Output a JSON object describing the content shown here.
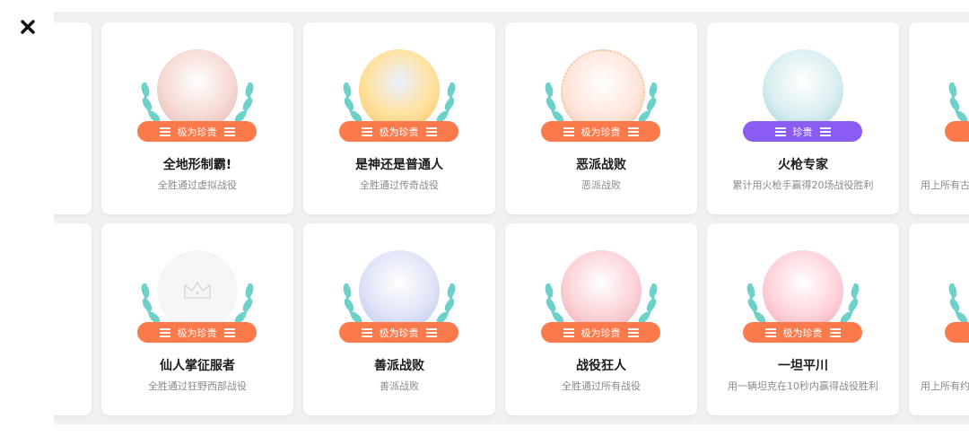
{
  "colors": {
    "badge_rare": "#fb7a4b",
    "badge_precious": "#8a5cf2",
    "laurel": "#6ed1c9",
    "background": "#f1f1f3"
  },
  "close_icon": "close-icon",
  "achievements": [
    {
      "title": "全地形制霸!",
      "desc": "全胜通过虚拟战役",
      "badge": "极为珍贵",
      "tone": "#ffd8d2"
    },
    {
      "title": "是神还是普通人",
      "desc": "全胜通过传奇战役",
      "badge": "极为珍贵",
      "tone": "#ffe7b8"
    },
    {
      "title": "恶派战败",
      "desc": "恶派战败",
      "badge": "极为珍贵",
      "tone": "#ffe1d6"
    },
    {
      "title": "火枪专家",
      "desc": "累计用火枪手赢得20场战役胜利",
      "badge": "珍贵",
      "tone": "#dfeff2"
    },
    {
      "title": "",
      "desc": "用上所有古",
      "badge": "",
      "tone": "#ffe6dc"
    },
    {
      "title": "仙人掌征服者",
      "desc": "全胜通过狂野西部战役",
      "badge": "极为珍贵",
      "tone": "#f4f4f4"
    },
    {
      "title": "善派战败",
      "desc": "善派战败",
      "badge": "极为珍贵",
      "tone": "#dfe3f7"
    },
    {
      "title": "战役狂人",
      "desc": "全胜通过所有战役",
      "badge": "极为珍贵",
      "tone": "#fbd2d6"
    },
    {
      "title": "一坦平川",
      "desc": "用一辆坦克在10秒内赢得战役胜利",
      "badge": "极为珍贵",
      "tone": "#ffd2da"
    },
    {
      "title": "",
      "desc": "用上所有约",
      "badge": "",
      "tone": "#ffe6dc"
    }
  ]
}
